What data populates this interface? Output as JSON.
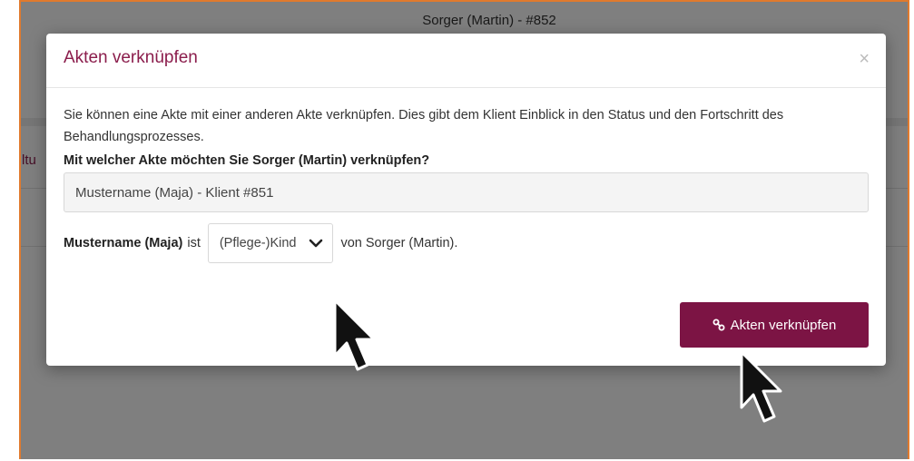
{
  "background": {
    "window_title": "Sorger (Martin) - #852",
    "cropped_label": "ltu"
  },
  "dialog": {
    "title": "Akten verknüpfen",
    "close_glyph": "×",
    "intro_text": "Sie können eine Akte mit einer anderen Akte verknüpfen. Dies gibt dem Klient Einblick in den Status und den Fortschritt des Behandlungsprozesses.",
    "question": "Mit welcher Akte möchten Sie Sorger (Martin) verknüpfen?",
    "selected_file": "Mustername (Maja) - Klient #851",
    "relation": {
      "subject": "Mustername (Maja)",
      "connector": "ist",
      "selected_relation": "(Pflege-)Kind",
      "suffix": "von Sorger (Martin)."
    },
    "submit_label": "Akten verknüpfen"
  },
  "colors": {
    "accent": "#8b1d4c",
    "button_bg": "#7c1444",
    "frame_border": "#e07a2e"
  },
  "icons": [
    "close-icon",
    "chevron-down-icon",
    "link-icon",
    "mouse-pointer-icon"
  ]
}
